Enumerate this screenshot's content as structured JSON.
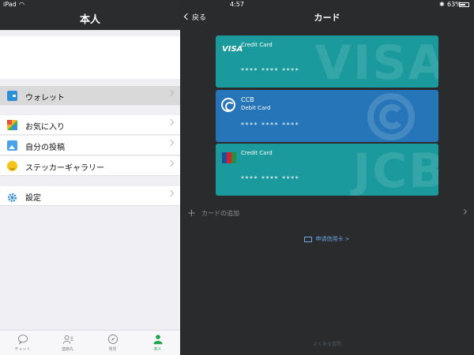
{
  "status_bar": {
    "device": "iPad",
    "time": "4:57",
    "battery": "63%",
    "battery_level": 0.63
  },
  "left_panel": {
    "title": "本人",
    "menu": [
      {
        "label": "ウォレット",
        "icon": "wallet-icon",
        "selected": true
      },
      {
        "label": "お気に入り",
        "icon": "favorites-icon"
      },
      {
        "label": "自分の投稿",
        "icon": "posts-icon"
      },
      {
        "label": "ステッカーギャラリー",
        "icon": "sticker-icon"
      },
      {
        "label": "設定",
        "icon": "settings-icon"
      }
    ],
    "tabs": [
      {
        "label": "チャット",
        "icon": "chat-icon"
      },
      {
        "label": "連絡先",
        "icon": "contacts-icon"
      },
      {
        "label": "発見",
        "icon": "compass-icon"
      },
      {
        "label": "本人",
        "icon": "person-icon",
        "active": true
      }
    ]
  },
  "right_panel": {
    "back_label": "戻る",
    "title": "カード",
    "cards": [
      {
        "brand": "",
        "type": "Credit Card",
        "number": "**** **** ****",
        "logo": "VISA",
        "color": "#1a9a9c"
      },
      {
        "brand": "CCB",
        "type": "Debit Card",
        "number": "**** **** ****",
        "logo": "ccb-logo",
        "color": "#2575b8"
      },
      {
        "brand": "",
        "type": "Credit Card",
        "number": "**** **** ****",
        "logo": "JCB",
        "color": "#1a9a9c"
      }
    ],
    "add_card_label": "カードの追加",
    "apply_link": "申请信用卡 >",
    "faq_link": "よくある質問"
  },
  "colors": {
    "accent_green": "#1aa34a",
    "link_blue": "#6aa9e6",
    "card_teal": "#1a9a9c",
    "card_blue": "#2575b8"
  }
}
